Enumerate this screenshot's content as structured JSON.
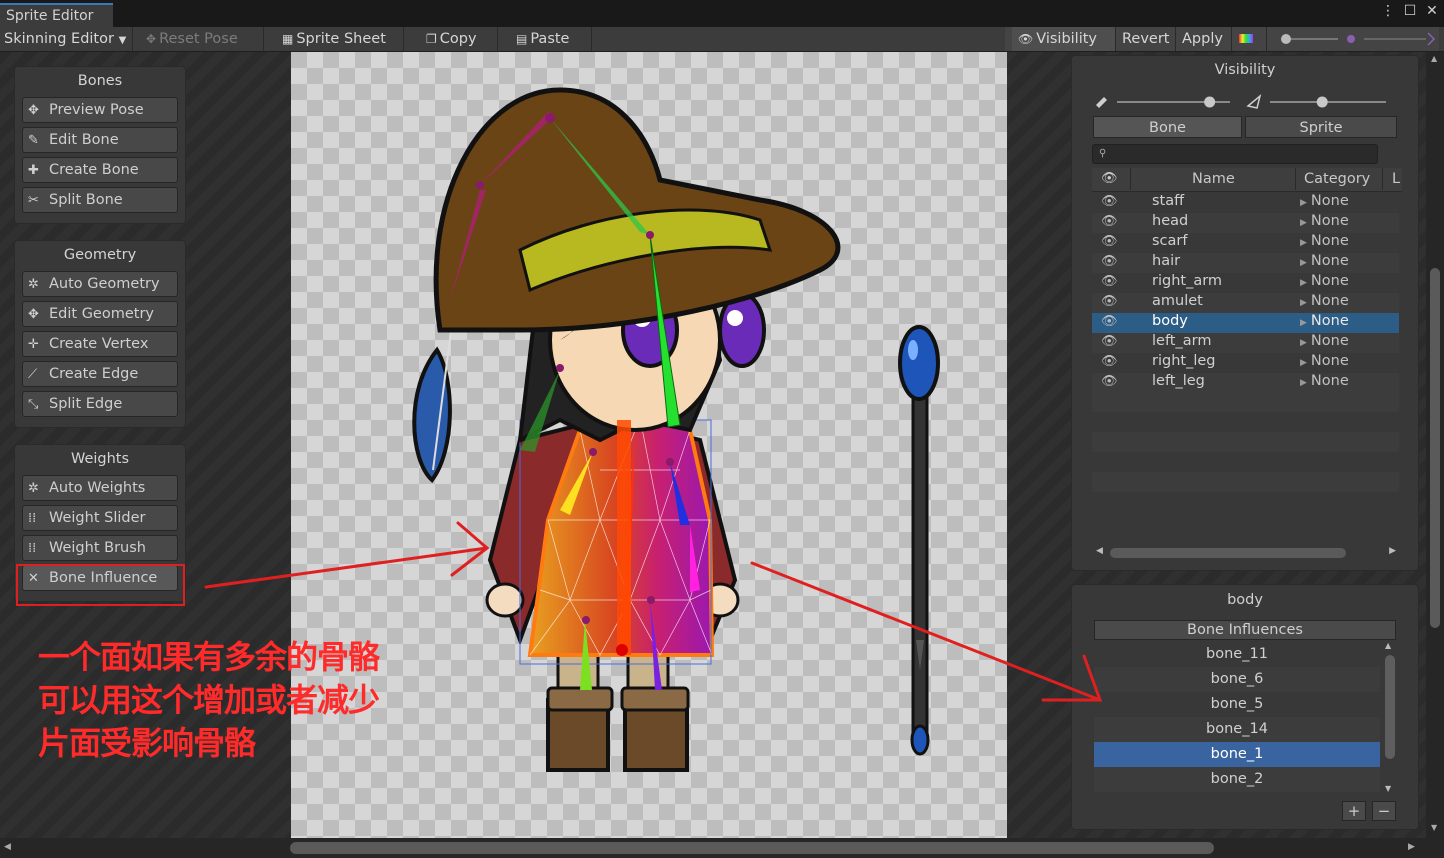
{
  "window": {
    "tab_title": "Sprite Editor",
    "controls": [
      "⋮",
      "☐",
      "✕"
    ]
  },
  "toolbar": {
    "mode_dropdown": "Skinning Editor",
    "reset_pose": "Reset Pose",
    "sprite_sheet": "Sprite Sheet",
    "copy": "Copy",
    "paste": "Paste",
    "visibility": "Visibility",
    "revert": "Revert",
    "apply": "Apply"
  },
  "tools": {
    "bones": {
      "title": "Bones",
      "buttons": [
        {
          "label": "Preview Pose",
          "icon": "preview-pose-icon"
        },
        {
          "label": "Edit Bone",
          "icon": "edit-bone-icon"
        },
        {
          "label": "Create Bone",
          "icon": "create-bone-icon"
        },
        {
          "label": "Split Bone",
          "icon": "split-bone-icon"
        }
      ]
    },
    "geometry": {
      "title": "Geometry",
      "buttons": [
        {
          "label": "Auto Geometry",
          "icon": "auto-geometry-icon"
        },
        {
          "label": "Edit Geometry",
          "icon": "edit-geometry-icon"
        },
        {
          "label": "Create Vertex",
          "icon": "create-vertex-icon"
        },
        {
          "label": "Create Edge",
          "icon": "create-edge-icon"
        },
        {
          "label": "Split Edge",
          "icon": "split-edge-icon"
        }
      ]
    },
    "weights": {
      "title": "Weights",
      "buttons": [
        {
          "label": "Auto Weights",
          "icon": "auto-weights-icon"
        },
        {
          "label": "Weight Slider",
          "icon": "weight-slider-icon"
        },
        {
          "label": "Weight Brush",
          "icon": "weight-brush-icon"
        },
        {
          "label": "Bone Influence",
          "icon": "bone-influence-icon"
        }
      ]
    }
  },
  "visibility_panel": {
    "title": "Visibility",
    "bone_opacity": 0.82,
    "sprite_opacity": 0.45,
    "tabs": [
      "Bone",
      "Sprite"
    ],
    "columns": [
      "Name",
      "Category",
      "L"
    ],
    "rows": [
      {
        "name": "staff",
        "category": "None"
      },
      {
        "name": "head",
        "category": "None"
      },
      {
        "name": "scarf",
        "category": "None"
      },
      {
        "name": "hair",
        "category": "None"
      },
      {
        "name": "right_arm",
        "category": "None"
      },
      {
        "name": "amulet",
        "category": "None"
      },
      {
        "name": "body",
        "category": "None"
      },
      {
        "name": "left_arm",
        "category": "None"
      },
      {
        "name": "right_leg",
        "category": "None"
      },
      {
        "name": "left_leg",
        "category": "None"
      }
    ],
    "selected_row": "body"
  },
  "influence_panel": {
    "title": "body",
    "header": "Bone Influences",
    "bones": [
      "bone_11",
      "bone_6",
      "bone_5",
      "bone_14",
      "bone_1",
      "bone_2"
    ],
    "selected": "bone_1",
    "add": "+",
    "remove": "−"
  },
  "annotation": {
    "lines": [
      "一个面如果有多余的骨骼",
      "可以用这个增加或者减少",
      "片面受影响骨骼"
    ],
    "color": "#ff2a2a"
  },
  "colors": {
    "selection": "#2c5d87",
    "highlight": "#e02020",
    "panel": "#383838"
  }
}
